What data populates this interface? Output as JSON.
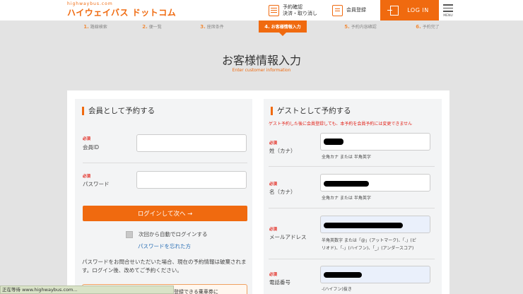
{
  "header": {
    "logo_small": "highwaybus.com",
    "logo_main": "ハイウェイバス ドットコム",
    "confirm_line1": "予約確認",
    "confirm_line2": "決済・取り消し",
    "member_register": "会員登録",
    "login": "LOG IN",
    "menu": "MENU"
  },
  "steps": [
    {
      "num": "1.",
      "label": "路線検索"
    },
    {
      "num": "2.",
      "label": "便一覧"
    },
    {
      "num": "3.",
      "label": "座席条件"
    },
    {
      "num": "4.",
      "label": "お客様情報入力"
    },
    {
      "num": "5.",
      "label": "予約内容確認"
    },
    {
      "num": "6.",
      "label": "予約完了"
    }
  ],
  "page": {
    "title": "お客様情報入力",
    "subtitle": "Enter customer information"
  },
  "member": {
    "title": "会員として予約する",
    "required": "必須",
    "id_label": "会員ID",
    "password_label": "パスワード",
    "login_button": "ログインして次へ →",
    "auto_login": "次回から自動でログインする",
    "forgot": "パスワードを忘れた方",
    "notice": "パスワードをお問合せいただいた場合、現在の予約情報は破棄されます。ログイン後、改めてご予約ください。",
    "bottom_text": "場合に登録できる乗車券に"
  },
  "guest": {
    "title": "ゲストとして予約する",
    "note": "ゲスト予約した後に会員登録しても、本予約を会員予約には変更できません",
    "required": "必須",
    "last_name_label": "姓（カナ）",
    "first_name_label": "名（カナ）",
    "email_label": "メールアドレス",
    "phone_label": "電話番号",
    "kana_hint": "全角カナ または 半角英字",
    "email_hint_1": "半角英数字 または「@」(アットマーク)、「.」(ピ",
    "email_hint_2": "リオド)、「-」(ハイフン)、「_」(アンダースコア)",
    "phone_hint": "-(ハイフン)抜き"
  },
  "statusbar": {
    "text": "正在等待 www.highwaybus.com..."
  },
  "colors": {
    "accent": "#f06a0f",
    "required": "#e2231a",
    "link": "#2a6fb5"
  }
}
